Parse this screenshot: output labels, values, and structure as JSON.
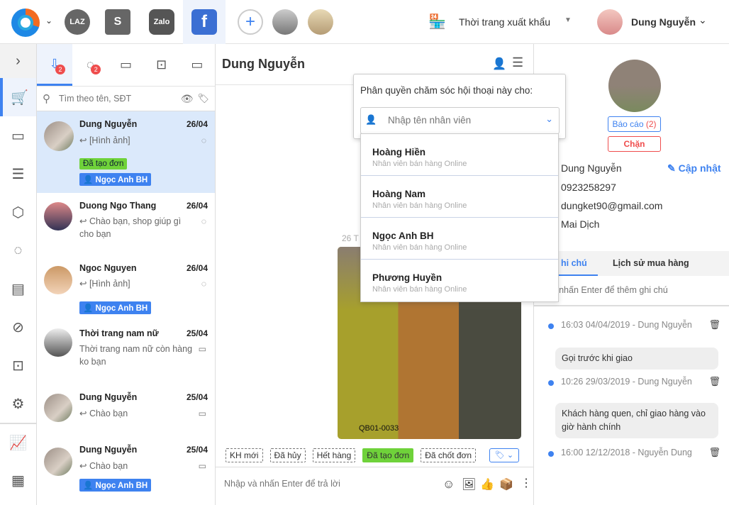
{
  "topbar": {
    "channels": [
      "LAZ",
      "S",
      "Zalo",
      "f"
    ],
    "store_name": "Thời trang xuất khẩu",
    "user_name": "Dung Nguyễn"
  },
  "search": {
    "placeholder": "Tìm theo tên, SĐT"
  },
  "tabs": [
    {
      "icon": "inbox-icon",
      "badge": "2"
    },
    {
      "icon": "messenger-icon",
      "badge": "2"
    },
    {
      "icon": "comment-icon"
    },
    {
      "icon": "bot-icon"
    },
    {
      "icon": "video-icon"
    }
  ],
  "conversations": [
    {
      "name": "Dung Nguyễn",
      "date": "26/04",
      "msg": "[Hình ảnh]",
      "tag": "Đã tạo đơn",
      "assignee": "Ngọc Anh BH"
    },
    {
      "name": "Duong Ngo Thang",
      "date": "26/04",
      "msg": "Chào bạn, shop giúp gì cho bạn"
    },
    {
      "name": "Ngoc Nguyen",
      "date": "26/04",
      "msg": "[Hình ảnh]",
      "assignee": "Ngọc Anh BH"
    },
    {
      "name": "Thời trang nam nữ",
      "date": "25/04",
      "msg": "Thời trang nam nữ còn hàng ko bạn"
    },
    {
      "name": "Dung Nguyễn",
      "date": "25/04",
      "msg": "Chào bạn"
    },
    {
      "name": "Dung Nguyễn",
      "date": "25/04",
      "msg": "Chào bạn",
      "assignee": "Ngọc Anh BH"
    }
  ],
  "chat": {
    "title": "Dung Nguyễn",
    "date_partial": "26 T",
    "image_code": "QB01-0033",
    "labels": [
      "KH mới",
      "Đã hủy",
      "Hết hàng",
      "Đã tạo đơn",
      "Đã chốt đơn"
    ],
    "reply_placeholder": "Nhập và nhấn Enter để trả lời"
  },
  "assign": {
    "title": "Phân quyền chăm sóc hội thoại này cho:",
    "placeholder": "Nhập tên nhân viên",
    "options": [
      {
        "name": "Hoàng Hiền",
        "role": "Nhân viên bán hàng Online"
      },
      {
        "name": "Hoàng Nam",
        "role": "Nhân viên bán hàng Online"
      },
      {
        "name": "Ngọc Anh BH",
        "role": "Nhân viên bán hàng Online"
      },
      {
        "name": "Phương Huyền",
        "role": "Nhân viên bán hàng Online"
      }
    ]
  },
  "profile": {
    "report_label": "Báo cáo",
    "report_count": "(2)",
    "block_label": "Chặn",
    "name": "Dung Nguyễn",
    "update_label": "Cập nhật",
    "phone": "0923258297",
    "email": "dungket90@gmail.com",
    "address": "Mai Dịch",
    "tabs": [
      "hi chú",
      "Lịch sử mua hàng"
    ],
    "note_placeholder": "p và nhấn Enter để thêm ghi chú",
    "notes": [
      {
        "meta": "16:03  04/04/2019  - Dung Nguyễn",
        "text": "Gọi trước khi giao"
      },
      {
        "meta": "10:26  29/03/2019  - Dung Nguyễn",
        "text": "Khách hàng quen, chỉ giao hàng vào giờ hành chính"
      },
      {
        "meta": "16:00  12/12/2018  - Nguyễn Dung",
        "text": ""
      }
    ]
  },
  "colors": {
    "accent": "#3e82f0",
    "green": "#6fd23a",
    "red": "#ef4d4d"
  }
}
